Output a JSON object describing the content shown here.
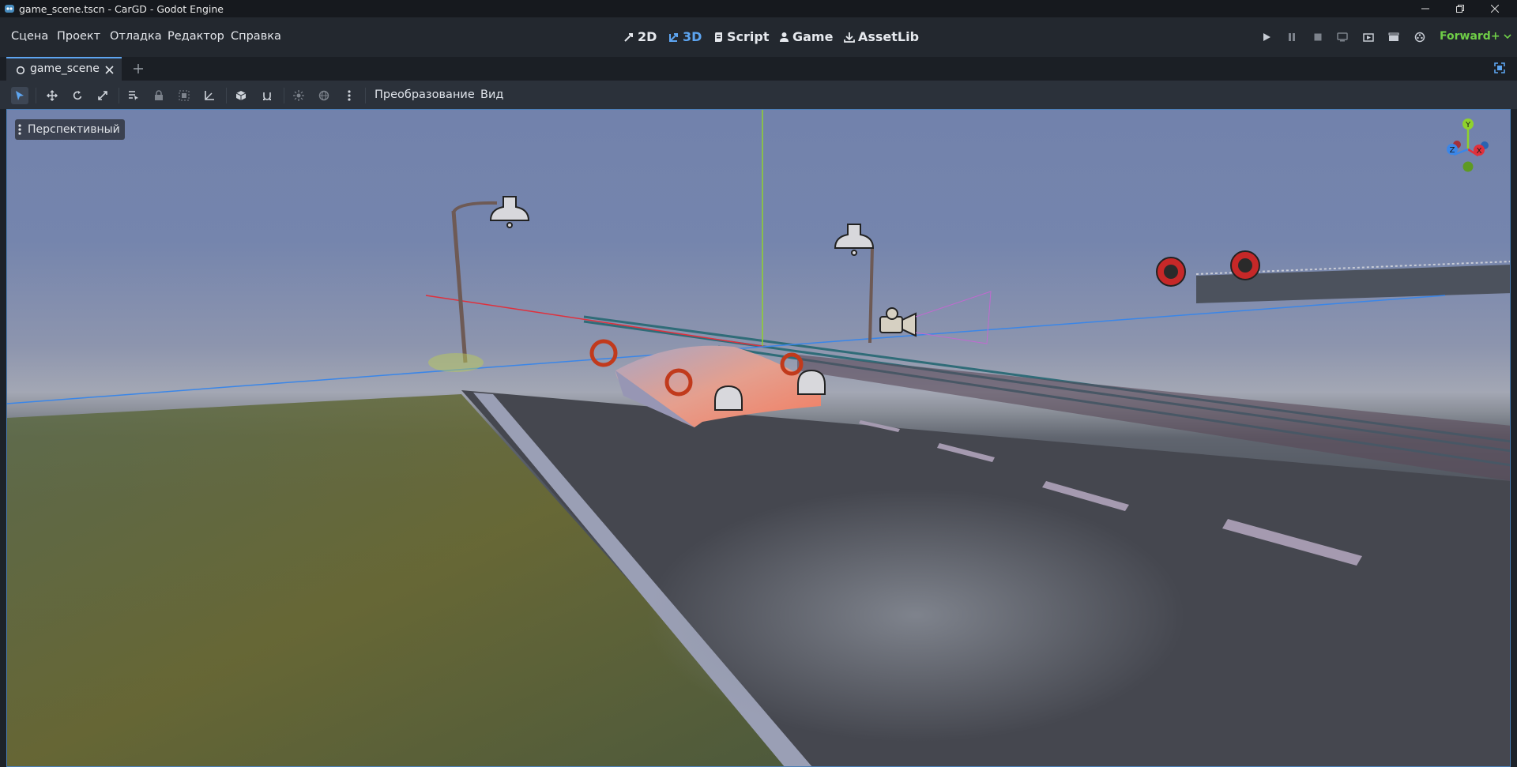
{
  "window": {
    "title": "game_scene.tscn - CarGD - Godot Engine"
  },
  "menu": {
    "items": [
      "Сцена",
      "Проект",
      "Отладка",
      "Редактор",
      "Справка"
    ]
  },
  "workspaces": {
    "items": [
      "2D",
      "3D",
      "Script",
      "Game",
      "AssetLib"
    ],
    "active": "3D"
  },
  "renderer": {
    "label": "Forward+"
  },
  "tabs": {
    "scene_tab": "game_scene"
  },
  "toolbar": {
    "transform_menu": "Преобразование",
    "view_menu": "Вид"
  },
  "viewport": {
    "perspective_label": "Перспективный",
    "gizmo": {
      "y": "Y",
      "x": "X",
      "z": "Z"
    }
  },
  "colors": {
    "accent": "#5da5f1",
    "renderer": "#6fcf47",
    "axis_x": "#e0303c",
    "axis_y": "#8fd22c",
    "axis_z": "#3a86e8"
  },
  "icons": {
    "app": "godot-icon",
    "scene_tab": "node3d-icon",
    "tab_close": "close-icon",
    "new_tab": "plus-icon",
    "distraction_free": "expand-icon"
  }
}
